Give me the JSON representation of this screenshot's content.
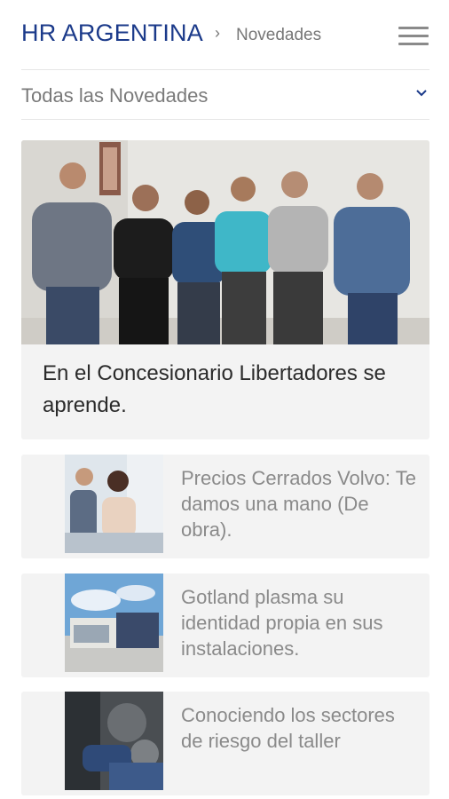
{
  "header": {
    "brand": "HR ARGENTINA",
    "separator": "›",
    "section": "Novedades",
    "menu_icon": "hamburger-menu-icon"
  },
  "filter": {
    "label": "Todas las Novedades",
    "icon": "chevron-down-icon",
    "accent": "#1b3a8a"
  },
  "featured": {
    "title": "En el Concesionario Libertadores se aprende."
  },
  "news": [
    {
      "title": "Precios Cerrados Volvo: Te damos una mano (De obra)."
    },
    {
      "title": "Gotland plasma su identidad propia en sus instalaciones."
    },
    {
      "title": "Conociendo los sectores de riesgo del taller"
    }
  ]
}
